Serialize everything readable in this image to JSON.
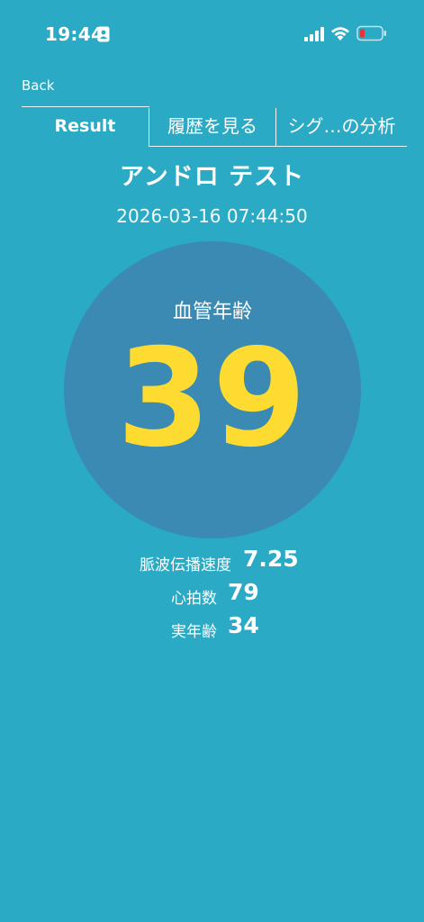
{
  "status": {
    "time": "19:44"
  },
  "nav": {
    "back_label": "Back"
  },
  "tabs": [
    {
      "label": "Result",
      "selected": true
    },
    {
      "label": "履歴を見る",
      "selected": false
    },
    {
      "label": "シグ…の分析",
      "selected": false
    }
  ],
  "header": {
    "title": "アンドロ テスト",
    "timestamp": "2026-03-16 07:44:50"
  },
  "result": {
    "label": "血管年齢",
    "value": "39"
  },
  "metrics": [
    {
      "label": "脈波伝播速度",
      "value": "7.25"
    },
    {
      "label": "心拍数",
      "value": "79"
    },
    {
      "label": "実年齢",
      "value": "34"
    }
  ],
  "colors": {
    "background": "#2aaac4",
    "circle": "#3a8ab3",
    "accent": "#fddb30",
    "battery_low": "#e8333a"
  }
}
